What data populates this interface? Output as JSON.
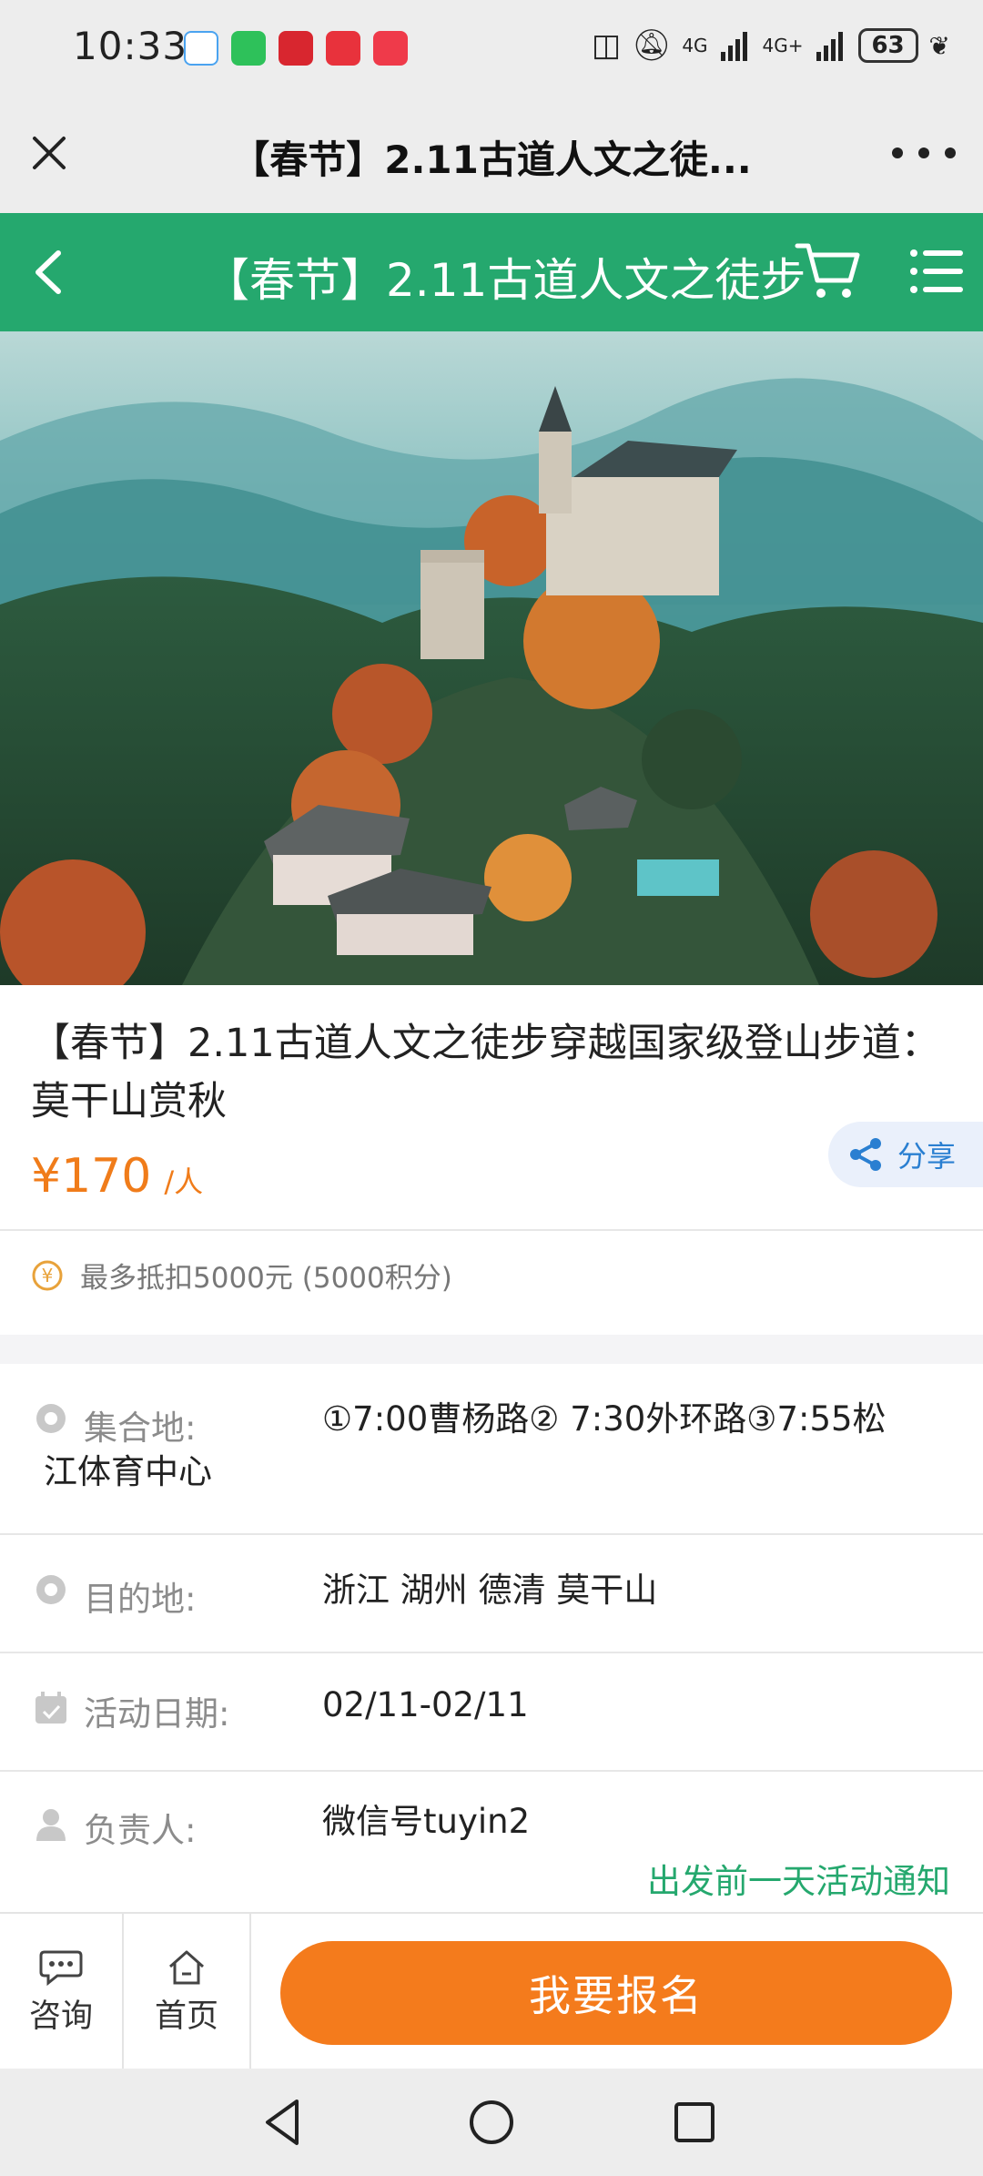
{
  "status_bar": {
    "time": "10:33",
    "battery": "63",
    "network_labels": [
      "4G",
      "4G+"
    ]
  },
  "web_header": {
    "title": "【春节】2.11古道人文之徒..."
  },
  "app_bar": {
    "title": "【春节】2.11古道人文之徒步",
    "bg_color": "#25a86e"
  },
  "product": {
    "title": "【春节】2.11古道人文之徒步穿越国家级登山步道：莫干山赏秋",
    "price": "¥170",
    "price_unit": "/人",
    "share_label": "分享",
    "points_note": "最多抵扣5000元 (5000积分)",
    "accent_color": "#f07c1a"
  },
  "info": {
    "meeting": {
      "label": "集合地:",
      "value_line1": "①7:00曹杨路② 7:30外环路③7:55松",
      "value_line2": "江体育中心"
    },
    "destination": {
      "label": "目的地:",
      "value": "浙江 湖州 德清 莫干山"
    },
    "date": {
      "label": "活动日期:",
      "value": "02/11-02/11"
    },
    "leader": {
      "label": "负责人:",
      "value": "微信号tuyin2"
    },
    "notice": "出发前一天活动通知"
  },
  "bottom_bar": {
    "consult_label": "咨询",
    "home_label": "首页",
    "signup_label": "我要报名"
  },
  "icons": {
    "close": "close-icon",
    "more": "more-icon",
    "back": "back-icon",
    "cart": "cart-icon",
    "menu": "menu-icon",
    "share": "share-icon",
    "coin": "coin-icon",
    "location": "location-pin-icon",
    "calendar": "calendar-icon",
    "person": "person-icon",
    "chat": "chat-icon",
    "home": "home-icon"
  }
}
